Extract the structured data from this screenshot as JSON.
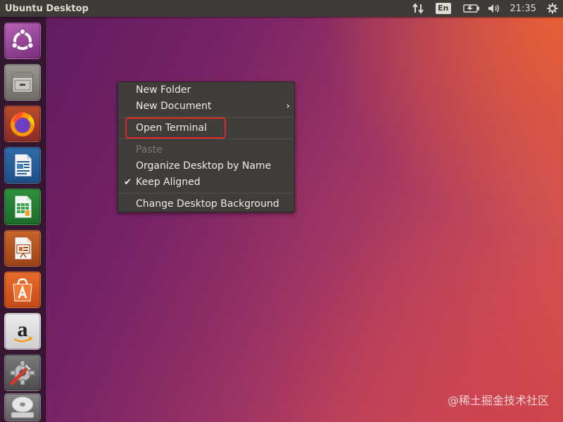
{
  "top_panel": {
    "title": "Ubuntu Desktop",
    "indicators": {
      "language": "En",
      "clock": "21:35"
    }
  },
  "launcher": {
    "items": [
      {
        "icon": "ubuntu-logo-icon"
      },
      {
        "icon": "files-icon"
      },
      {
        "icon": "firefox-icon"
      },
      {
        "icon": "libreoffice-writer-icon"
      },
      {
        "icon": "libreoffice-calc-icon"
      },
      {
        "icon": "libreoffice-impress-icon"
      },
      {
        "icon": "ubuntu-software-icon"
      },
      {
        "icon": "amazon-icon"
      },
      {
        "icon": "system-settings-icon"
      },
      {
        "icon": "optical-disc-icon"
      }
    ]
  },
  "context_menu": {
    "items": [
      {
        "label": "New Folder"
      },
      {
        "label": "New Document",
        "has_submenu": true,
        "submenu_arrow": "›"
      },
      {
        "label": "Open Terminal",
        "highlighted": true
      },
      {
        "label": "Paste",
        "disabled": true
      },
      {
        "label": "Organize Desktop by Name"
      },
      {
        "label": "Keep Aligned",
        "checked": true,
        "check_mark": "✔"
      },
      {
        "label": "Change Desktop Background"
      }
    ]
  },
  "colors": {
    "panel": "#3c3b37",
    "menu": "#3e3d39",
    "highlight_box": "#e32626"
  },
  "watermark": "@稀土掘金技术社区"
}
